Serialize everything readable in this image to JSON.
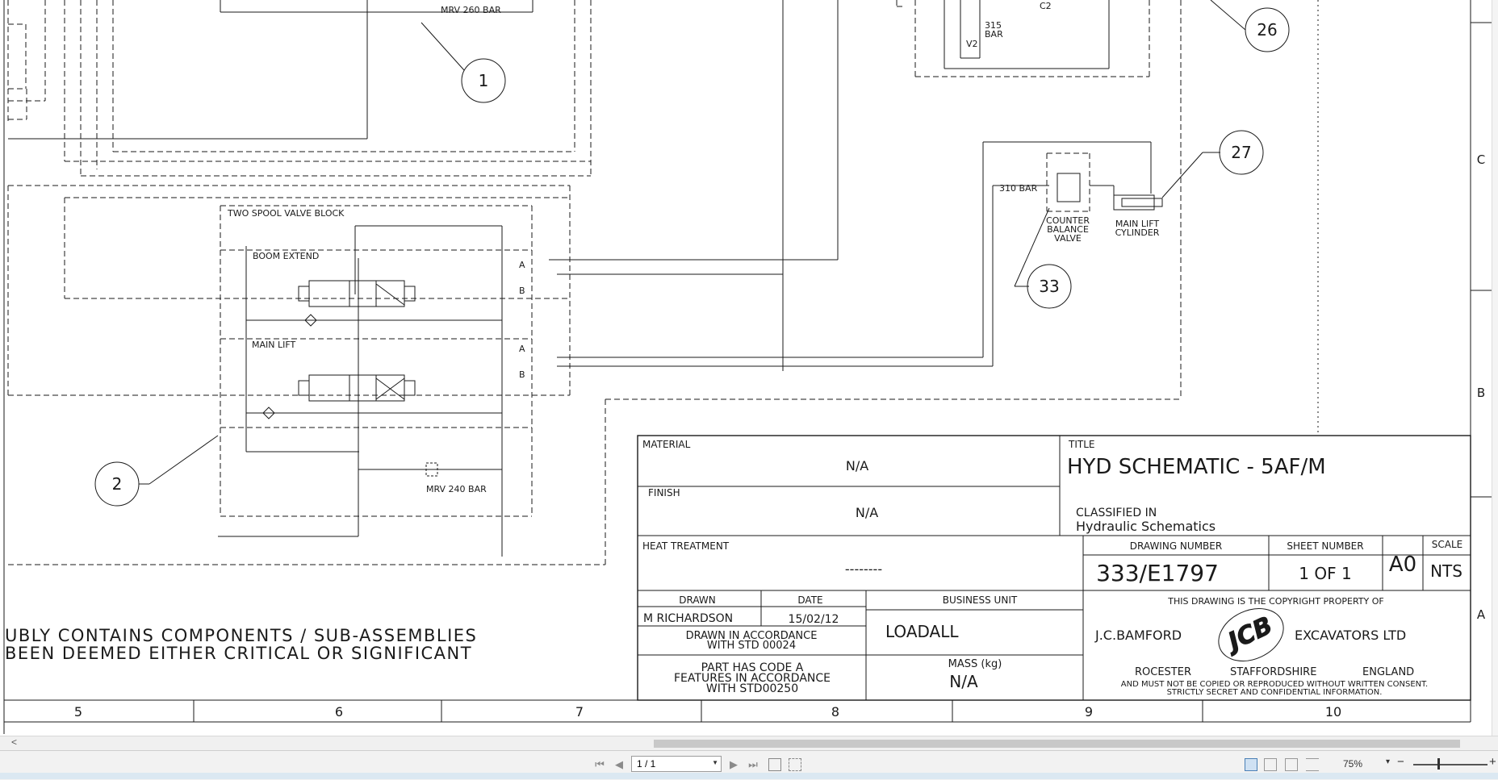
{
  "viewer": {
    "page_field_value": "1 / 1",
    "zoom_level": "75%",
    "zoom_out_symbol": "−",
    "zoom_in_symbol": "+"
  },
  "schematic": {
    "callouts": [
      "1",
      "2",
      "26",
      "27",
      "33"
    ],
    "labels": {
      "mrv_top": "MRV 260 BAR",
      "mrv_bottom": "MRV 240 BAR",
      "two_spool": "TWO SPOOL VALVE BLOCK",
      "boom_extend": "BOOM EXTEND",
      "main_lift": "MAIN LIFT",
      "port_a": "A",
      "port_b": "B",
      "bar_310": "310 BAR",
      "counter_balance": [
        "COUNTER",
        "BALANCE",
        "VALVE"
      ],
      "main_lift_cyl": [
        "MAIN LIFT",
        "CYLINDER"
      ],
      "bar_315": [
        "315",
        "BAR"
      ],
      "c2": "C2",
      "v2": "V2"
    },
    "note_lines": [
      "UBLY CONTAINS COMPONENTS / SUB-ASSEMBLIES",
      "BEEN DEEMED EITHER CRITICAL OR SIGNIFICANT"
    ],
    "zone_letters": [
      "C",
      "B",
      "A"
    ],
    "column_numbers": [
      "5",
      "6",
      "7",
      "8",
      "9",
      "10"
    ]
  },
  "title_block": {
    "material_label": "MATERIAL",
    "material_value": "N/A",
    "finish_label": "FINISH",
    "finish_value": "N/A",
    "heat_label": "HEAT TREATMENT",
    "heat_value": "--------",
    "title_label": "TITLE",
    "title_value": "HYD SCHEMATIC - 5AF/M",
    "classified_label": "CLASSIFIED IN",
    "classified_value": "Hydraulic Schematics",
    "drawing_number_label": "DRAWING NUMBER",
    "drawing_number": "333/E1797",
    "sheet_number_label": "SHEET NUMBER",
    "sheet_number": "1 OF 1",
    "size": "A0",
    "scale_label": "SCALE",
    "scale": "NTS",
    "drawn_label": "DRAWN",
    "drawn_by": "M RICHARDSON",
    "date_label": "DATE",
    "date": "15/02/12",
    "accordance_lines": [
      "DRAWN IN ACCORDANCE",
      "WITH STD 00024"
    ],
    "part_code_lines": [
      "PART HAS CODE A",
      "FEATURES IN ACCORDANCE",
      "WITH STD00250"
    ],
    "business_unit_label": "BUSINESS UNIT",
    "business_unit": "LOADALL",
    "mass_label": "MASS (kg)",
    "mass": "N/A",
    "copyright_line": "THIS DRAWING IS THE COPYRIGHT PROPERTY OF",
    "company_left": "J.C.BAMFORD",
    "company_right": "EXCAVATORS LTD",
    "logo_text": "JCB",
    "town": "ROCESTER",
    "county": "STAFFORDSHIRE",
    "country": "ENGLAND",
    "legal_line_1": "AND MUST NOT BE COPIED OR REPRODUCED WITHOUT WRITTEN CONSENT.",
    "legal_line_2": "STRICTLY SECRET AND CONFIDENTIAL INFORMATION."
  },
  "colors": {
    "line": "#1a1a1a",
    "statusbar": "#f2f2f2",
    "taskbar": "#dbe8f2"
  }
}
